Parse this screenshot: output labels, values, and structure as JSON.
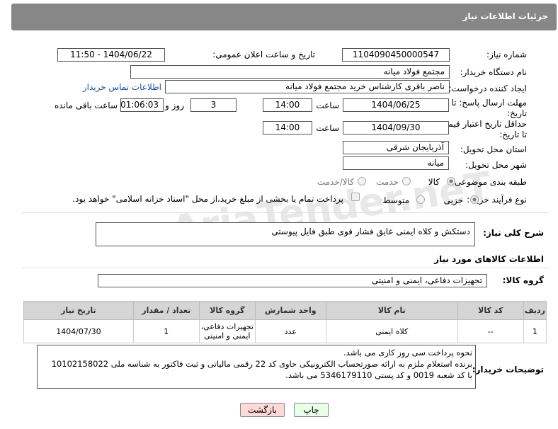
{
  "header": {
    "title": "جزئیات اطلاعات نیاز"
  },
  "watermark": {
    "text": "AriaTender.neT"
  },
  "form": {
    "need_number_label": "شماره نیاز:",
    "need_number": "1104090450000547",
    "announce_label": "تاریخ و ساعت اعلان عمومی:",
    "announce_value": "1404/06/22 - 11:50",
    "buyer_org_label": "نام دستگاه خریدار:",
    "buyer_org": "مجتمع فولاد میانه",
    "creator_label": "ایجاد کننده درخواست:",
    "creator": "ناصر باقری کارشناس خرید مجتمع فولاد میانه",
    "contact_link": "اطلاعات تماس خریدار",
    "reply_deadline_label_1": "مهلت ارسال پاسخ: تا",
    "reply_deadline_label_2": "تاریخ:",
    "reply_date": "1404/06/25",
    "time_word": "ساعت",
    "reply_time": "14:00",
    "days_value": "3",
    "days_word": "روز و",
    "remaining_time": "01:06:03",
    "remaining_word": "ساعت باقی مانده",
    "price_validity_label_1": "حداقل تاریخ اعتبار قیمت:",
    "price_validity_label_2": "تا تاریخ:",
    "price_date": "1404/09/30",
    "price_time": "14:00",
    "province_label": "استان محل تحویل:",
    "province": "آذربایجان شرقی",
    "city_label": "شهر محل تحویل:",
    "city": "میانه",
    "category_label": "طبقه بندی موضوعی:",
    "category_options": [
      "کالا",
      "خدمت",
      "کالا/خدمت"
    ],
    "process_label": "نوع فرآیند خرید :",
    "process_options": [
      "جزیی",
      "متوسط"
    ],
    "payment_note": "پرداخت تمام یا بخشی از مبلغ خرید،از محل \"اسناد خزانه اسلامی\" خواهد بود."
  },
  "description": {
    "label": "شرح کلی نیاز:",
    "text": "دستکش و کلاه ایمنی عایق فشار قوی طبق فایل پیوستی"
  },
  "goods": {
    "section_title": "اطلاعات کالاهای مورد نیاز",
    "group_label": "گروه کالا:",
    "group_value": "تجهیزات دفاعی، ایمنی و امنیتی",
    "columns": [
      "ردیف",
      "کد کالا",
      "نام کالا",
      "واحد شمارش",
      "گروه کالا",
      "تعداد / مقدار",
      "تاریخ نیاز"
    ],
    "rows": [
      {
        "row": "1",
        "code": "--",
        "name": "کلاه ایمنی",
        "unit": "عدد",
        "group_line1": "تجهیزات دفاعی،",
        "group_line2": "ایمنی و امنیتی",
        "qty": "1",
        "date": "1404/07/30"
      }
    ]
  },
  "buyer_notes": {
    "label": "توضیحات خریدار:",
    "line1": "نحوه پرداخت سی روز کاری می باشد.",
    "line2": "برنده استعلام ملزم به ارائه صورتحساب الکترونیکی حاوی کد 22 رقمی مالیاتی و ثبت فاکتور به شناسه ملی 10102158022",
    "line3": "با کد شعبه 0019 و کد پستی 5346179110 می باشد."
  },
  "buttons": {
    "print": "چاپ",
    "back": "بازگشت"
  },
  "colors": {
    "header_bg": "#878787",
    "link": "#1f4ea8",
    "back_button_bg": "#ffd9d9",
    "print_button_bg": "#e8ffe8",
    "table_header_bg": "#d5d5d5"
  }
}
